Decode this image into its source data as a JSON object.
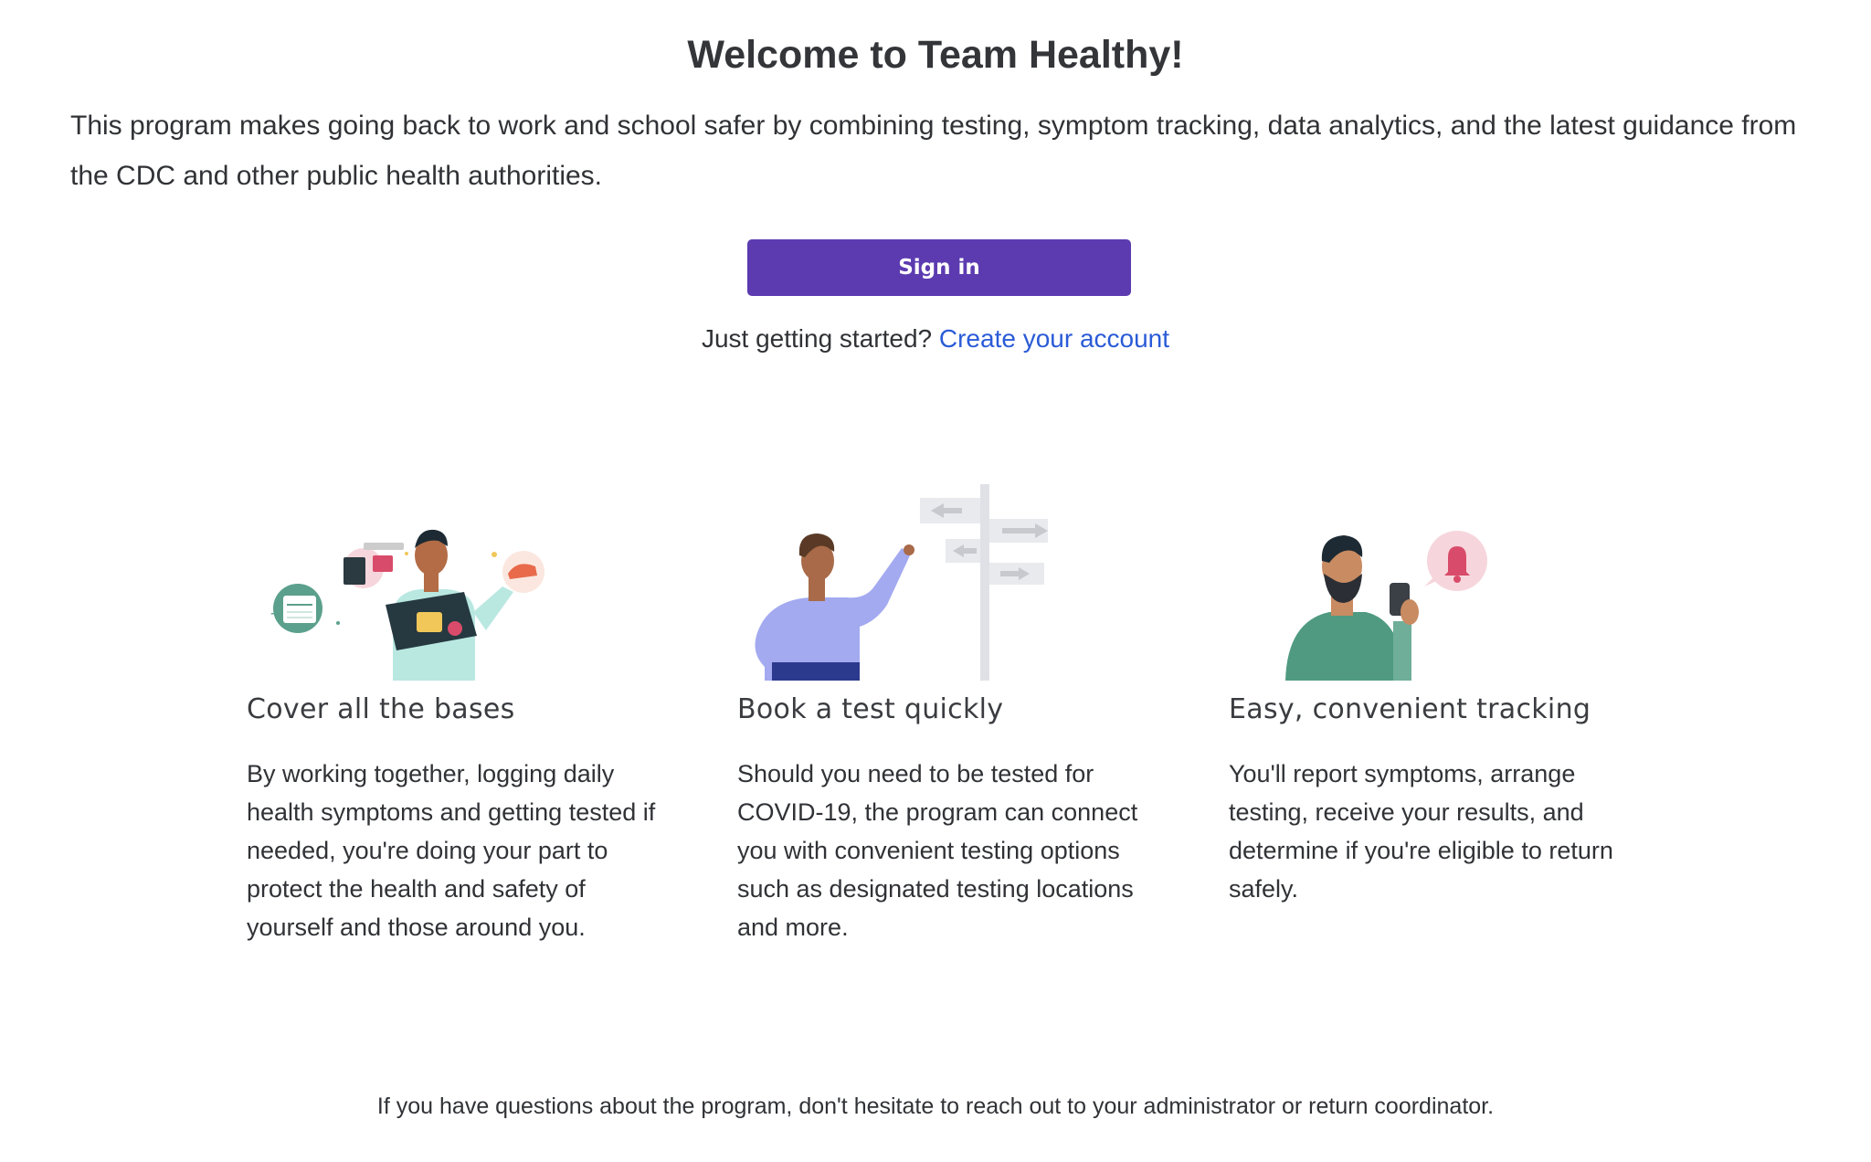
{
  "header": {
    "title": "Welcome to Team Healthy!",
    "intro": "This program makes going back to work and school safer by combining testing, symptom tracking, data analytics, and the latest guidance from the CDC and other public health authorities."
  },
  "auth": {
    "sign_in_label": "Sign in",
    "signup_prompt": "Just getting started?",
    "signup_link": "Create your account"
  },
  "features": [
    {
      "title": "Cover all the bases",
      "text": "By working together, logging daily health symptoms and getting tested if needed, you're doing your part to protect the health and safety of yourself and those around you.",
      "icon": "person-with-toolbox-illustration"
    },
    {
      "title": "Book a test quickly",
      "text": "Should you need to be tested for COVID-19, the program can connect you with convenient testing options such as designated testing locations and more.",
      "icon": "person-at-signpost-illustration"
    },
    {
      "title": "Easy, convenient tracking",
      "text": "You'll report symptoms, arrange testing, receive your results, and determine if you're eligible to return safely.",
      "icon": "person-with-phone-notification-illustration"
    }
  ],
  "footer": {
    "note": "If you have questions about the program, don't hesitate to reach out to your administrator or return coordinator."
  },
  "colors": {
    "primary_button": "#5c3bb0",
    "link": "#2a5bd7",
    "text": "#303236"
  }
}
